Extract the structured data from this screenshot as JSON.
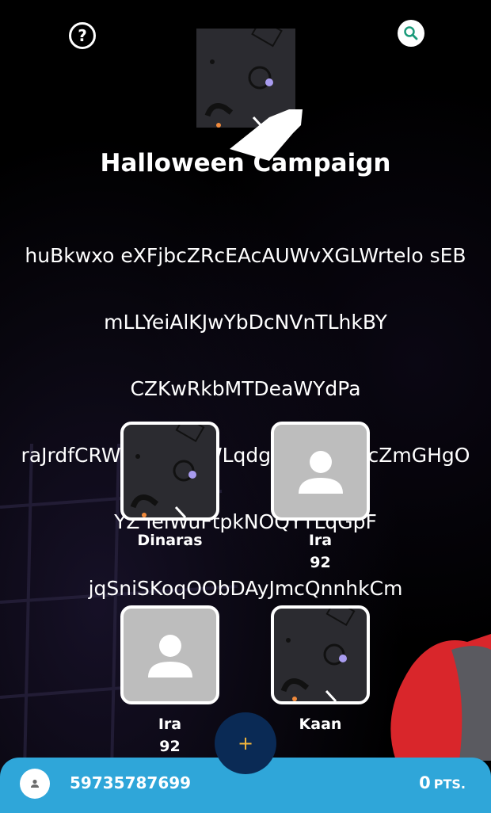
{
  "header": {
    "help_icon": "question-circle-icon",
    "search_icon": "search-icon"
  },
  "campaign": {
    "title": "Halloween Campaign",
    "description_lines": [
      "huBkwxo eXFjbcZRcEAcAUWvXGLWrtelo sEB",
      "mLLYeiAlKJwYbDcNVnTLhkBY",
      "CZKwRkbMTDeaWYdPa",
      "raJrdfCRWGzywqOWLqdgEyUsFVSzcZmGHgO",
      "YZ ieiWuFtpkNOQYTLqGpF",
      "jqSniSKoqOObDAyJmcQnnhkCm"
    ]
  },
  "members": [
    {
      "name": "Dinaras",
      "score": "",
      "avatar": "logo-image"
    },
    {
      "name": "Ira",
      "score": "92",
      "avatar": "person-placeholder-icon"
    },
    {
      "name": "Ira",
      "score": "92",
      "avatar": "person-placeholder-icon"
    },
    {
      "name": "Kaan",
      "score": "",
      "avatar": "logo-image"
    }
  ],
  "fab": {
    "label": "+"
  },
  "bottom_bar": {
    "user_id": "59735787699",
    "points_value": "0",
    "points_unit": "PTS."
  },
  "colors": {
    "background": "#000000",
    "bottom_bar": "#2fa6d9",
    "fab": "#0a2a55",
    "fab_plus": "#f3b63b",
    "search_icon": "#1a9a7a",
    "placeholder_avatar": "#bdbdbd"
  }
}
